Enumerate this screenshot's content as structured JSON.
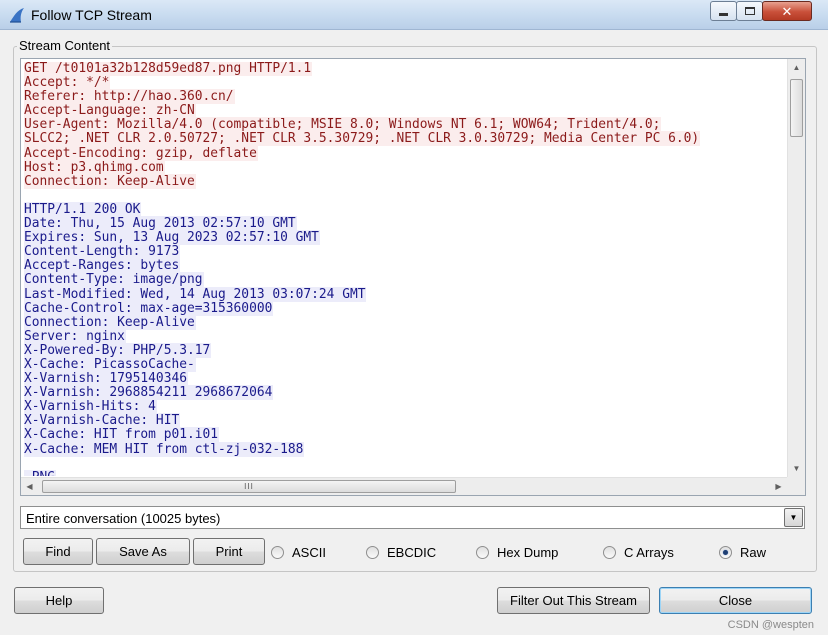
{
  "window": {
    "title": "Follow TCP Stream",
    "minimize_icon": "minimize-icon",
    "maximize_icon": "maximize-icon",
    "close_icon": "close-icon",
    "close_glyph": "✕"
  },
  "stream": {
    "group_label": "Stream Content",
    "colors": {
      "client_bg": "#fbeded",
      "client_fg": "#8b1a1a",
      "server_bg": "#ececfa",
      "server_fg": "#1a1a8b"
    },
    "lines": [
      {
        "dir": "client",
        "text": "GET /t0101a32b128d59ed87.png HTTP/1.1"
      },
      {
        "dir": "client",
        "text": "Accept: */*"
      },
      {
        "dir": "client",
        "text": "Referer: http://hao.360.cn/"
      },
      {
        "dir": "client",
        "text": "Accept-Language: zh-CN"
      },
      {
        "dir": "client",
        "text": "User-Agent: Mozilla/4.0 (compatible; MSIE 8.0; Windows NT 6.1; WOW64; Trident/4.0;"
      },
      {
        "dir": "client",
        "text": "SLCC2; .NET CLR 2.0.50727; .NET CLR 3.5.30729; .NET CLR 3.0.30729; Media Center PC 6.0)"
      },
      {
        "dir": "client",
        "text": "Accept-Encoding: gzip, deflate"
      },
      {
        "dir": "client",
        "text": "Host: p3.qhimg.com"
      },
      {
        "dir": "client",
        "text": "Connection: Keep-Alive"
      },
      {
        "dir": "blank",
        "text": ""
      },
      {
        "dir": "server",
        "text": "HTTP/1.1 200 OK"
      },
      {
        "dir": "server",
        "text": "Date: Thu, 15 Aug 2013 02:57:10 GMT"
      },
      {
        "dir": "server",
        "text": "Expires: Sun, 13 Aug 2023 02:57:10 GMT"
      },
      {
        "dir": "server",
        "text": "Content-Length: 9173"
      },
      {
        "dir": "server",
        "text": "Accept-Ranges: bytes"
      },
      {
        "dir": "server",
        "text": "Content-Type: image/png"
      },
      {
        "dir": "server",
        "text": "Last-Modified: Wed, 14 Aug 2013 03:07:24 GMT"
      },
      {
        "dir": "server",
        "text": "Cache-Control: max-age=315360000"
      },
      {
        "dir": "server",
        "text": "Connection: Keep-Alive"
      },
      {
        "dir": "server",
        "text": "Server: nginx"
      },
      {
        "dir": "server",
        "text": "X-Powered-By: PHP/5.3.17"
      },
      {
        "dir": "server",
        "text": "X-Cache: PicassoCache-"
      },
      {
        "dir": "server",
        "text": "X-Varnish: 1795140346"
      },
      {
        "dir": "server",
        "text": "X-Varnish: 2968854211 2968672064"
      },
      {
        "dir": "server",
        "text": "X-Varnish-Hits: 4"
      },
      {
        "dir": "server",
        "text": "X-Varnish-Cache: HIT"
      },
      {
        "dir": "server",
        "text": "X-Cache: HIT from p01.i01"
      },
      {
        "dir": "server",
        "text": "X-Cache: MEM HIT from ctl-zj-032-188"
      },
      {
        "dir": "blank",
        "text": ""
      },
      {
        "dir": "server",
        "text": ".PNG"
      }
    ],
    "vscroll": {
      "up_icon": "scroll-up-arrow-icon",
      "down_icon": "scroll-down-arrow-icon",
      "up_glyph": "▲",
      "down_glyph": "▼"
    },
    "hscroll": {
      "left_icon": "scroll-left-arrow-icon",
      "right_icon": "scroll-right-arrow-icon",
      "left_glyph": "◀",
      "right_glyph": "▶",
      "grip": "III"
    }
  },
  "conversation": {
    "selected": "Entire conversation (10025 bytes)",
    "dropdown_glyph": "▼"
  },
  "actions": {
    "find": "Find",
    "save_as": "Save As",
    "print": "Print"
  },
  "formats": {
    "selected": "Raw",
    "options": [
      "ASCII",
      "EBCDIC",
      "Hex Dump",
      "C Arrays",
      "Raw"
    ]
  },
  "footer": {
    "help": "Help",
    "filter_out": "Filter Out This Stream",
    "close": "Close"
  },
  "watermark": "CSDN @wespten"
}
